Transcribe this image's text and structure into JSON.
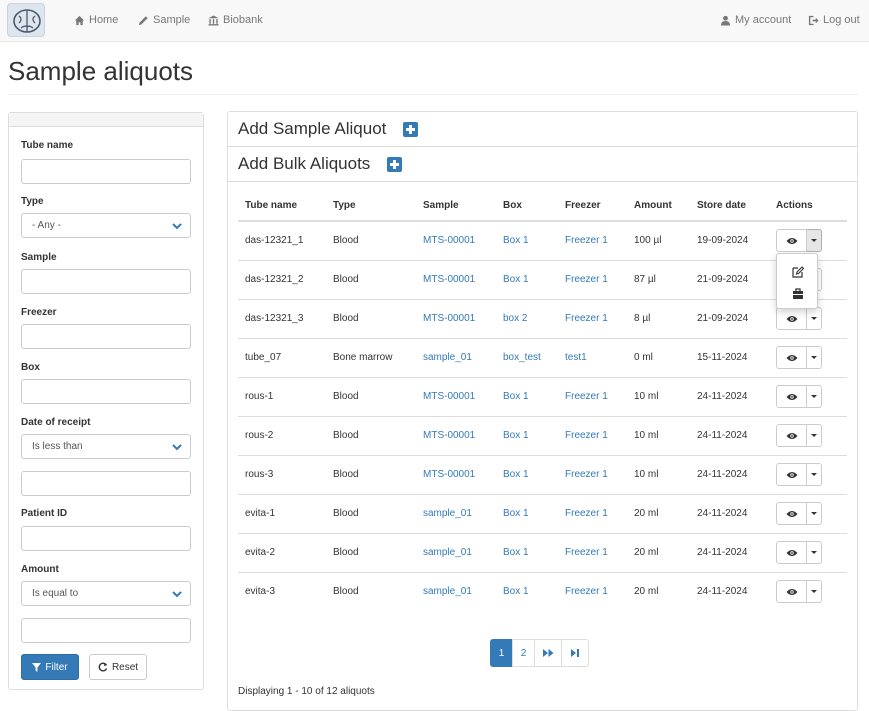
{
  "nav": {
    "home": "Home",
    "sample": "Sample",
    "biobank": "Biobank",
    "my_account": "My account",
    "log_out": "Log out"
  },
  "page_title": "Sample aliquots",
  "filters": {
    "tube_name_label": "Tube name",
    "type_label": "Type",
    "type_value": "- Any -",
    "sample_label": "Sample",
    "freezer_label": "Freezer",
    "box_label": "Box",
    "date_label": "Date of receipt",
    "date_operator": "Is less than",
    "patient_label": "Patient ID",
    "amount_label": "Amount",
    "amount_operator": "Is equal to",
    "filter_button": "Filter",
    "reset_button": "Reset"
  },
  "main": {
    "add_aliquot": "Add Sample Aliquot",
    "add_bulk": "Add Bulk Aliquots",
    "columns": [
      "Tube name",
      "Type",
      "Sample",
      "Box",
      "Freezer",
      "Amount",
      "Store date",
      "Actions"
    ],
    "rows": [
      {
        "tube": "das-12321_1",
        "type": "Blood",
        "sample": "MTS-00001",
        "box": "Box 1",
        "freezer": "Freezer 1",
        "amount": "100 µl",
        "date": "19-09-2024"
      },
      {
        "tube": "das-12321_2",
        "type": "Blood",
        "sample": "MTS-00001",
        "box": "Box 1",
        "freezer": "Freezer 1",
        "amount": "87 µl",
        "date": "21-09-2024"
      },
      {
        "tube": "das-12321_3",
        "type": "Blood",
        "sample": "MTS-00001",
        "box": "box 2",
        "freezer": "Freezer 1",
        "amount": "8 µl",
        "date": "21-09-2024"
      },
      {
        "tube": "tube_07",
        "type": "Bone marrow",
        "sample": "sample_01",
        "box": "box_test",
        "freezer": "test1",
        "amount": "0 ml",
        "date": "15-11-2024"
      },
      {
        "tube": "rous-1",
        "type": "Blood",
        "sample": "MTS-00001",
        "box": "Box 1",
        "freezer": "Freezer 1",
        "amount": "10 ml",
        "date": "24-11-2024"
      },
      {
        "tube": "rous-2",
        "type": "Blood",
        "sample": "MTS-00001",
        "box": "Box 1",
        "freezer": "Freezer 1",
        "amount": "10 ml",
        "date": "24-11-2024"
      },
      {
        "tube": "rous-3",
        "type": "Blood",
        "sample": "MTS-00001",
        "box": "Box 1",
        "freezer": "Freezer 1",
        "amount": "10 ml",
        "date": "24-11-2024"
      },
      {
        "tube": "evita-1",
        "type": "Blood",
        "sample": "sample_01",
        "box": "Box 1",
        "freezer": "Freezer 1",
        "amount": "20 ml",
        "date": "24-11-2024"
      },
      {
        "tube": "evita-2",
        "type": "Blood",
        "sample": "sample_01",
        "box": "Box 1",
        "freezer": "Freezer 1",
        "amount": "20 ml",
        "date": "24-11-2024"
      },
      {
        "tube": "evita-3",
        "type": "Blood",
        "sample": "sample_01",
        "box": "Box 1",
        "freezer": "Freezer 1",
        "amount": "20 ml",
        "date": "24-11-2024"
      }
    ],
    "pagination": {
      "page1": "1",
      "page2": "2"
    },
    "summary": "Displaying 1 - 10 of 12 aliquots"
  },
  "colors": {
    "primary": "#337ab7",
    "link": "#337ab7",
    "navbar": "#f8f8f8"
  },
  "icons": {
    "nav": [
      "brain-logo-icon",
      "home-icon",
      "pencil-icon",
      "bank-icon",
      "user-icon",
      "log-out-icon"
    ],
    "filter_button": "filter-icon",
    "reset_button": "refresh-icon",
    "row_actions": [
      "eye-icon",
      "caret-down-icon"
    ],
    "dropdown": [
      "edit-icon",
      "box-icon"
    ],
    "pager": [
      "fast-forward-icon",
      "last-page-icon"
    ]
  }
}
